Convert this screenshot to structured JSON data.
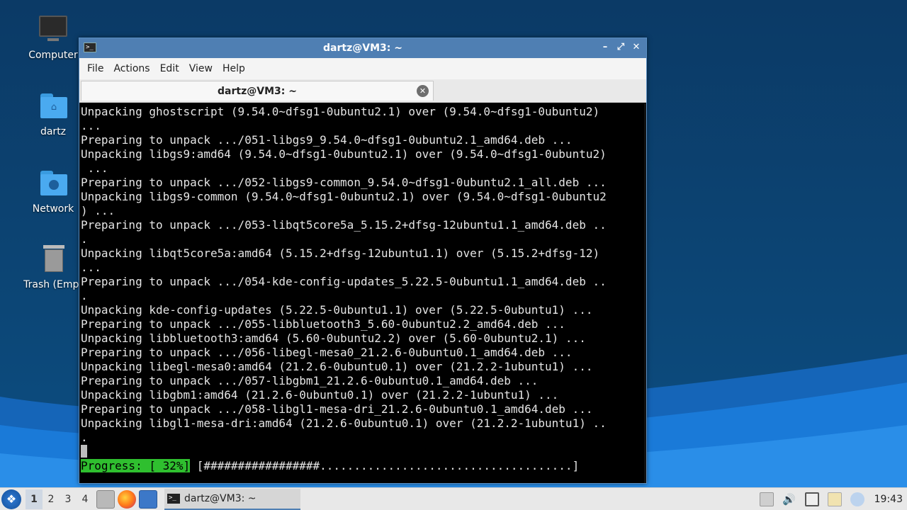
{
  "desktop": {
    "icons": [
      {
        "label": "Computer",
        "icon": "computer-icon"
      },
      {
        "label": "dartz",
        "icon": "home-folder-icon"
      },
      {
        "label": "Network",
        "icon": "network-folder-icon"
      },
      {
        "label": "Trash (Empt",
        "icon": "trash-icon"
      }
    ]
  },
  "window": {
    "title": "dartz@VM3: ~",
    "menu": [
      "File",
      "Actions",
      "Edit",
      "View",
      "Help"
    ],
    "tab_label": "dartz@VM3: ~",
    "controls": {
      "minimize": "–",
      "maximize": "⤢",
      "close": "✕"
    }
  },
  "terminal": {
    "lines": [
      "Unpacking ghostscript (9.54.0~dfsg1-0ubuntu2.1) over (9.54.0~dfsg1-0ubuntu2)",
      "...",
      "Preparing to unpack .../051-libgs9_9.54.0~dfsg1-0ubuntu2.1_amd64.deb ...",
      "Unpacking libgs9:amd64 (9.54.0~dfsg1-0ubuntu2.1) over (9.54.0~dfsg1-0ubuntu2)",
      " ...",
      "Preparing to unpack .../052-libgs9-common_9.54.0~dfsg1-0ubuntu2.1_all.deb ...",
      "Unpacking libgs9-common (9.54.0~dfsg1-0ubuntu2.1) over (9.54.0~dfsg1-0ubuntu2",
      ") ...",
      "Preparing to unpack .../053-libqt5core5a_5.15.2+dfsg-12ubuntu1.1_amd64.deb ..",
      ".",
      "Unpacking libqt5core5a:amd64 (5.15.2+dfsg-12ubuntu1.1) over (5.15.2+dfsg-12)",
      "...",
      "Preparing to unpack .../054-kde-config-updates_5.22.5-0ubuntu1.1_amd64.deb ..",
      ".",
      "Unpacking kde-config-updates (5.22.5-0ubuntu1.1) over (5.22.5-0ubuntu1) ...",
      "Preparing to unpack .../055-libbluetooth3_5.60-0ubuntu2.2_amd64.deb ...",
      "Unpacking libbluetooth3:amd64 (5.60-0ubuntu2.2) over (5.60-0ubuntu2.1) ...",
      "Preparing to unpack .../056-libegl-mesa0_21.2.6-0ubuntu0.1_amd64.deb ...",
      "Unpacking libegl-mesa0:amd64 (21.2.6-0ubuntu0.1) over (21.2.2-1ubuntu1) ...",
      "Preparing to unpack .../057-libgbm1_21.2.6-0ubuntu0.1_amd64.deb ...",
      "Unpacking libgbm1:amd64 (21.2.6-0ubuntu0.1) over (21.2.2-1ubuntu1) ...",
      "Preparing to unpack .../058-libgl1-mesa-dri_21.2.6-0ubuntu0.1_amd64.deb ...",
      "Unpacking libgl1-mesa-dri:amd64 (21.2.6-0ubuntu0.1) over (21.2.2-1ubuntu1) ..",
      "."
    ],
    "progress_label": "Progress: [ 32%]",
    "progress_bar": " [#################.....................................]",
    "progress_percent": 32
  },
  "taskbar": {
    "workspaces": [
      "1",
      "2",
      "3",
      "4"
    ],
    "active_workspace": "1",
    "task_label": "dartz@VM3: ~",
    "clock": "19:43"
  }
}
